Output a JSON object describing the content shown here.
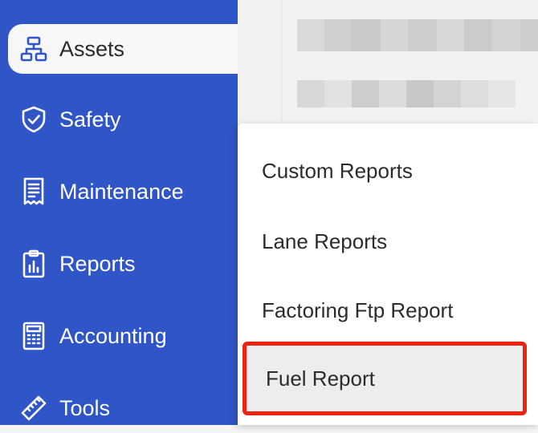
{
  "sidebar": {
    "items": [
      {
        "label": "Assets",
        "icon": "org-chart-icon",
        "active": true
      },
      {
        "label": "Safety",
        "icon": "shield-check-icon",
        "active": false
      },
      {
        "label": "Maintenance",
        "icon": "receipt-icon",
        "active": false
      },
      {
        "label": "Reports",
        "icon": "clipboard-chart-icon",
        "active": false
      },
      {
        "label": "Accounting",
        "icon": "calculator-icon",
        "active": false
      },
      {
        "label": "Tools",
        "icon": "ruler-icon",
        "active": false
      }
    ]
  },
  "dropdown": {
    "items": [
      {
        "label": "Custom Reports"
      },
      {
        "label": "Lane Reports"
      },
      {
        "label": "Factoring Ftp Report"
      },
      {
        "label": "Fuel Report",
        "highlighted": true
      }
    ]
  },
  "colors": {
    "sidebar": "#2f55c7",
    "highlight_border": "#ee2211",
    "active_bg": "#f7f7f7"
  }
}
